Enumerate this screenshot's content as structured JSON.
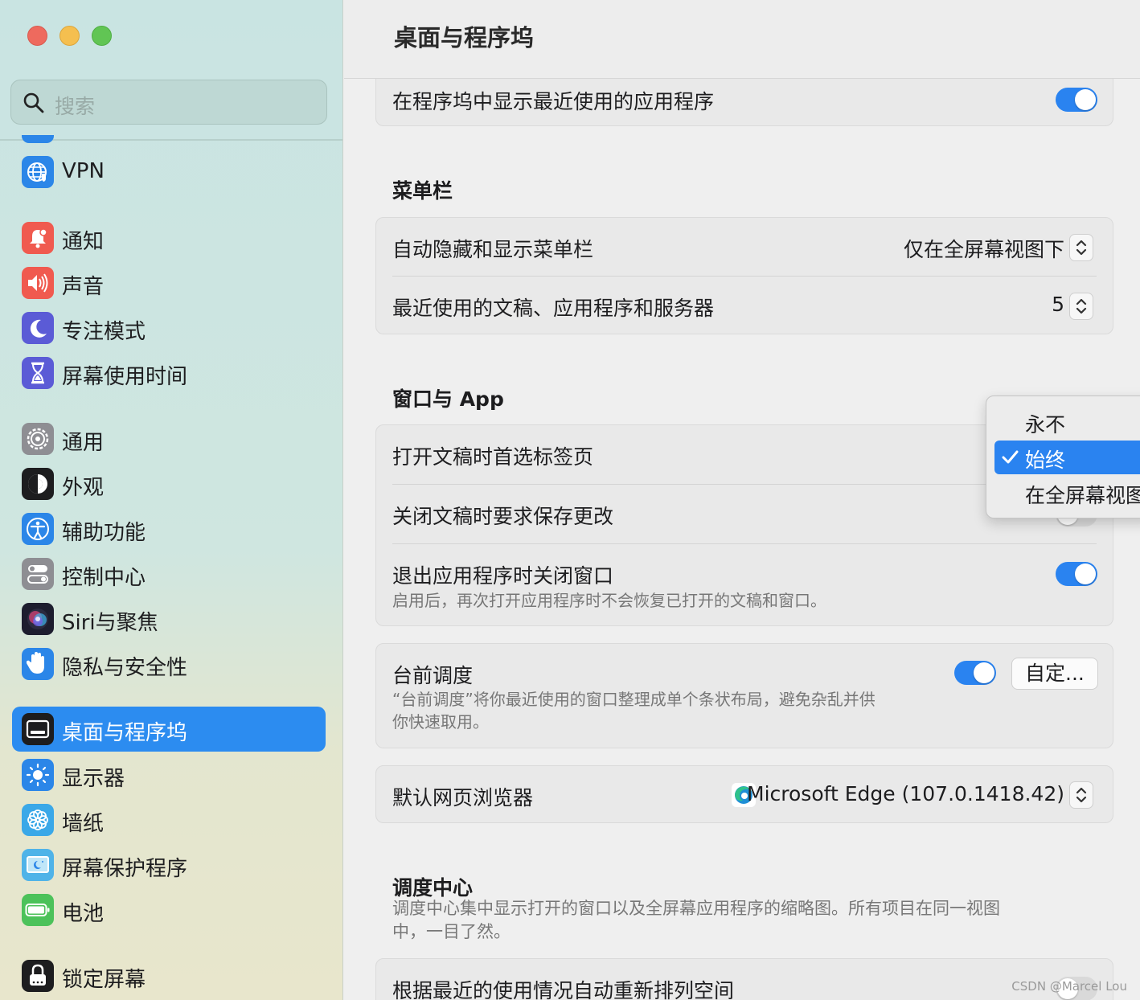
{
  "window": {
    "title": "桌面与程序坞"
  },
  "search": {
    "placeholder": "搜索"
  },
  "sidebar": {
    "items": [
      {
        "label": "VPN",
        "icon": "vpn-globe-icon",
        "color": "#2b86e8"
      },
      {
        "label": "通知",
        "icon": "bell-icon",
        "color": "#f05a4f"
      },
      {
        "label": "声音",
        "icon": "speaker-icon",
        "color": "#f05a4f"
      },
      {
        "label": "专注模式",
        "icon": "moon-icon",
        "color": "#5b5bd6"
      },
      {
        "label": "屏幕使用时间",
        "icon": "hourglass-icon",
        "color": "#5b5bd6"
      },
      {
        "label": "通用",
        "icon": "gear-icon",
        "color": "#8e8e93"
      },
      {
        "label": "外观",
        "icon": "appearance-icon",
        "color": "#1d1d1f"
      },
      {
        "label": "辅助功能",
        "icon": "accessibility-icon",
        "color": "#2b86e8"
      },
      {
        "label": "控制中心",
        "icon": "control-center-icon",
        "color": "#8e8e93"
      },
      {
        "label": "Siri与聚焦",
        "icon": "siri-icon",
        "color": "#2b2b40"
      },
      {
        "label": "隐私与安全性",
        "icon": "hand-icon",
        "color": "#2b86e8"
      },
      {
        "label": "桌面与程序坞",
        "icon": "dock-icon",
        "color": "#1d1d1f",
        "active": true
      },
      {
        "label": "显示器",
        "icon": "brightness-icon",
        "color": "#2b86e8"
      },
      {
        "label": "墙纸",
        "icon": "flower-icon",
        "color": "#3aa8e8"
      },
      {
        "label": "屏幕保护程序",
        "icon": "screensaver-icon",
        "color": "#4fb3e8"
      },
      {
        "label": "电池",
        "icon": "battery-icon",
        "color": "#4cc25a"
      },
      {
        "label": "锁定屏幕",
        "icon": "lock-icon",
        "color": "#1d1d1f"
      }
    ]
  },
  "main": {
    "dock_recent": {
      "label": "在程序坞中显示最近使用的应用程序",
      "on": true
    },
    "menubar": {
      "heading": "菜单栏",
      "autohide": {
        "label": "自动隐藏和显示菜单栏",
        "value": "仅在全屏幕视图下"
      },
      "recent": {
        "label": "最近使用的文稿、应用程序和服务器",
        "value": "5"
      }
    },
    "windows": {
      "heading": "窗口与 App",
      "prefer_tabs": {
        "label": "打开文稿时首选标签页"
      },
      "ask_save": {
        "label": "关闭文稿时要求保存更改",
        "on": false
      },
      "close_windows": {
        "label": "退出应用程序时关闭窗口",
        "desc": "启用后，再次打开应用程序时不会恢复已打开的文稿和窗口。",
        "on": true
      }
    },
    "stage_manager": {
      "label": "台前调度",
      "desc_line1": "“台前调度”将你最近使用的窗口整理成单个条状布局，避免杂乱并供",
      "desc_line2": "你快速取用。",
      "on": true,
      "button": "自定..."
    },
    "browser": {
      "label": "默认网页浏览器",
      "value": "Microsoft Edge (107.0.1418.42)"
    },
    "mission_control": {
      "heading": "调度中心",
      "desc_line1": "调度中心集中显示打开的窗口以及全屏幕应用程序的缩略图。所有项目在同一视图",
      "desc_line2": "中，一目了然。",
      "rearrange": {
        "label": "根据最近的使用情况自动重新排列空间",
        "on": false
      }
    }
  },
  "dropdown": {
    "options": [
      "永不",
      "始终",
      "在全屏幕视图"
    ],
    "selected": "始终"
  },
  "watermark": "CSDN @Marcel Lou",
  "colors": {
    "accent": "#2a83f0",
    "sidebar_active": "#2c8cf0"
  }
}
